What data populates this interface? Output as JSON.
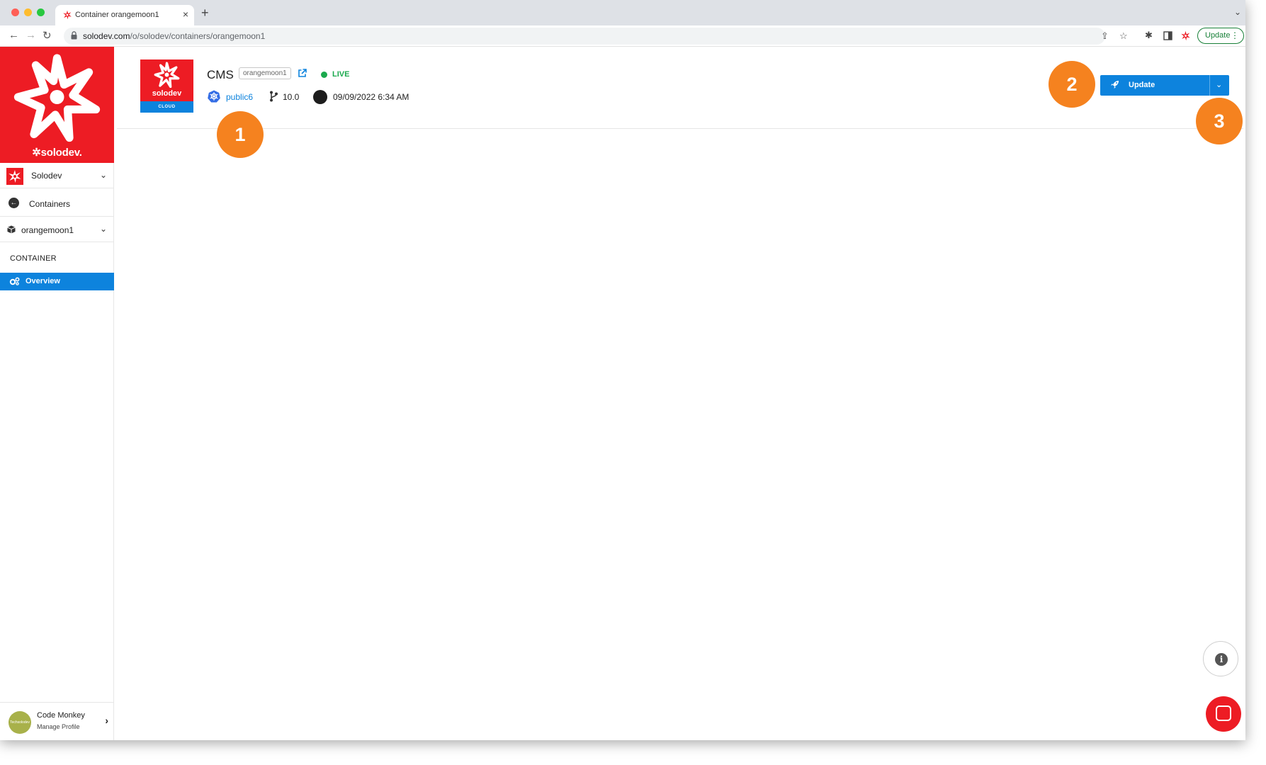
{
  "browser": {
    "tab_title": "Container orangemoon1",
    "new_tab_label": "+",
    "close_tab_label": "×",
    "url_host": "solodev.com",
    "url_path": "/o/solodev/containers/orangemoon1",
    "update_label": "Update",
    "menu_dots": "⋮"
  },
  "sidebar": {
    "brand_name": "solodev",
    "org_name": "Solodev",
    "back_label": "Containers",
    "container_name": "orangemoon1",
    "section_label": "CONTAINER",
    "nav_items": [
      {
        "label": "Overview",
        "active": true
      }
    ],
    "profile": {
      "name": "Code Monkey",
      "link": "Manage Profile",
      "avatar_text": "Techsolodev"
    }
  },
  "header": {
    "logo_name": "solodev",
    "logo_badge": "CLOUD",
    "title": "CMS",
    "container_id": "orangemoon1",
    "status": "LIVE",
    "cluster": "public6",
    "version": "10.0",
    "deployed_at": "09/09/2022 6:34 AM"
  },
  "actions": {
    "update_label": "Update"
  },
  "callouts": [
    "1",
    "2",
    "3"
  ],
  "colors": {
    "brand_red": "#ed1c24",
    "primary_blue": "#0d83dd",
    "live_green": "#1aa94d",
    "callout_orange": "#f5821f"
  }
}
